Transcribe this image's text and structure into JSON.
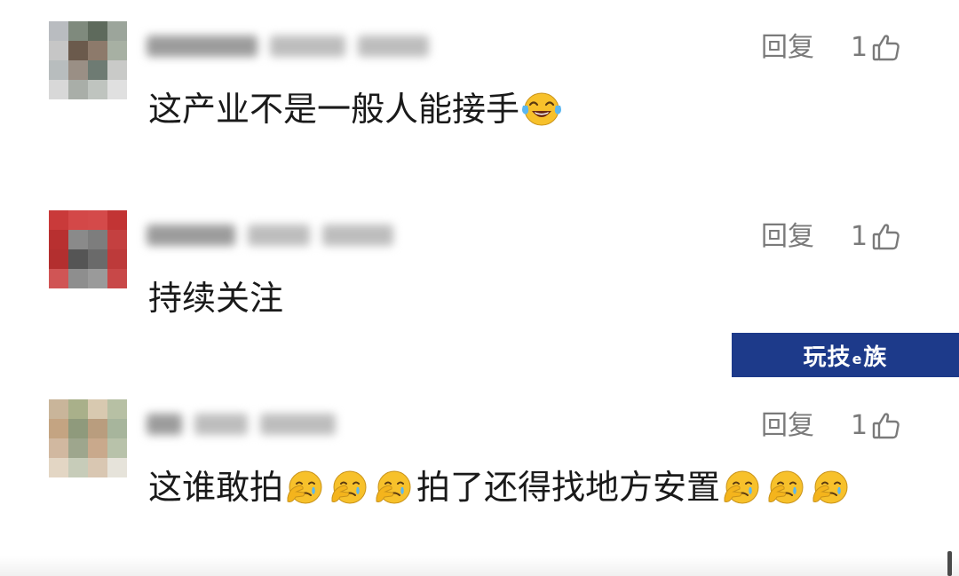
{
  "comments": [
    {
      "reply_label": "回复",
      "like_count": "1",
      "avatar_colors": [
        "#b9bcc0",
        "#7f8a7d",
        "#5e6a5c",
        "#9ca59b",
        "#c6c6c6",
        "#6b5a4c",
        "#8d7a6b",
        "#a7b0a3",
        "#b8bdbe",
        "#9a8f85",
        "#6e7b73",
        "#c9cac8",
        "#d8d8d8",
        "#a9aea8",
        "#bfc4bf",
        "#e0e0e0"
      ],
      "text_segments": [
        {
          "type": "text",
          "value": "这产业不是一般人能接手"
        },
        {
          "type": "emoji",
          "name": "tears-of-joy-emoji"
        }
      ]
    },
    {
      "reply_label": "回复",
      "like_count": "1",
      "avatar_colors": [
        "#c93a3a",
        "#d34848",
        "#d44a4a",
        "#c23434",
        "#b83030",
        "#8a8a8a",
        "#7d7d7d",
        "#c44040",
        "#b32f2f",
        "#555555",
        "#6a6a6a",
        "#bd3a3a",
        "#d05555",
        "#8e8e8e",
        "#9a9a9a",
        "#c84848"
      ],
      "text_segments": [
        {
          "type": "text",
          "value": "持续关注"
        }
      ]
    },
    {
      "reply_label": "回复",
      "like_count": "1",
      "avatar_colors": [
        "#c9b59a",
        "#a9b08a",
        "#d8c9b0",
        "#b7c0a4",
        "#c4a482",
        "#8f9a7c",
        "#b99d7e",
        "#a7b59c",
        "#d1b8a0",
        "#9ea68d",
        "#c9a98c",
        "#b8c2aa",
        "#e3d6c4",
        "#c7ccb9",
        "#d9c7b2",
        "#e6e3da"
      ],
      "text_segments": [
        {
          "type": "text",
          "value": "这谁敢拍"
        },
        {
          "type": "emoji",
          "name": "facepalm-emoji"
        },
        {
          "type": "emoji",
          "name": "facepalm-emoji"
        },
        {
          "type": "emoji",
          "name": "facepalm-emoji"
        },
        {
          "type": "text",
          "value": "拍了还得找地方安置"
        },
        {
          "type": "emoji",
          "name": "facepalm-emoji"
        },
        {
          "type": "emoji",
          "name": "facepalm-emoji"
        },
        {
          "type": "emoji",
          "name": "facepalm-emoji"
        }
      ]
    }
  ],
  "watermark": {
    "part1": "玩技",
    "part2": "e",
    "part3": "族",
    "background": "#1d3a8a"
  },
  "colors": {
    "text": "#1a1a1a",
    "meta": "#7a7a7a",
    "emoji_yellow": "#f7c12b"
  }
}
